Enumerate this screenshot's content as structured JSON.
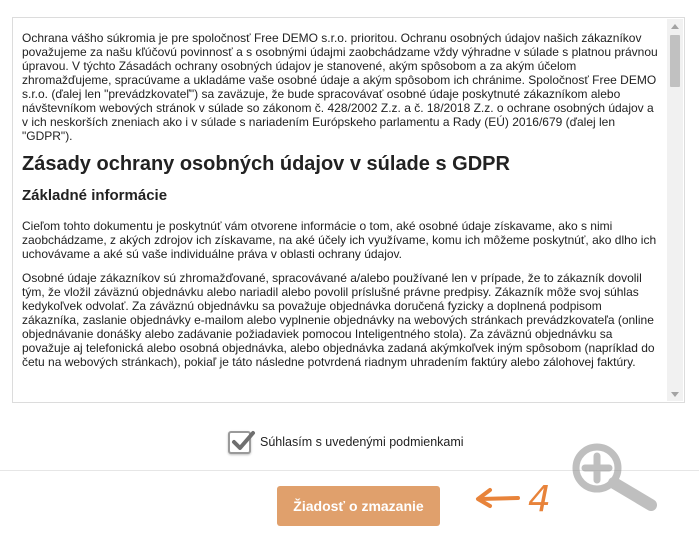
{
  "terms": {
    "intro": "Ochrana vášho súkromia je pre spoločnosť Free DEMO s.r.o. prioritou. Ochranu osobných údajov našich zákazníkov považujeme za našu kľúčovú povinnosť a s osobnými údajmi zaobchádzame vždy výhradne v súlade s platnou právnou úpravou. V týchto Zásadách ochrany osobných údajov je stanovené, akým spôsobom a za akým účelom zhromažďujeme, spracúvame a ukladáme vaše osobné údaje a akým spôsobom ich chránime. Spoločnosť Free DEMO s.r.o. (ďalej len \"prevádzkovateľ\") sa zaväzuje, že bude spracovávať osobné údaje poskytnuté zákazníkom alebo návštevníkom webových stránok v súlade so zákonom č. 428/2002 Z.z. a č. 18/2018 Z.z. o ochrane osobných údajov a v ich neskorších zneniach ako i v súlade s nariadením Európskeho parlamentu a Rady (EÚ) 2016/679 (ďalej len \"GDPR\").",
    "heading": "Zásady ochrany osobných údajov v súlade s GDPR",
    "subheading": "Základné informácie",
    "paragraph1": "Cieľom tohto dokumentu je poskytnúť vám otvorene informácie o tom, aké osobné údaje získavame, ako s nimi zaobchádzame, z akých zdrojov ich získavame, na aké účely ich využívame, komu ich môžeme poskytnúť, ako dlho ich uchovávame a aké sú vaše individuálne práva v oblasti ochrany údajov.",
    "paragraph2": "Osobné údaje zákazníkov sú zhromažďované, spracovávané a/alebo používané len v prípade, že to zákazník dovolil tým, že vložil záväznú objednávku alebo nariadil alebo povolil príslušné právne predpisy. Zákazník môže svoj súhlas kedykoľvek odvolať. Za záväznú objednávku sa považuje objednávka doručená fyzicky a doplnená podpisom zákazníka, zaslanie objednávky e-mailom alebo vyplnenie objednávky na webových stránkach prevádzkovateľa (online objednávanie donášky alebo zadávanie požiadaviek pomocou Inteligentného stola). Za záväznú objednávku sa považuje aj telefonická alebo osobná objednávka, alebo objednávka zadaná akýmkoľvek iným spôsobom (napríklad do četu na webových stránkach), pokiaľ je táto následne potvrdená riadnym uhradením faktúry alebo zálohovej faktúry."
  },
  "consent": {
    "label": "Súhlasím s uvedenými podmienkami",
    "checked": true
  },
  "actions": {
    "delete_request_label": "Žiadosť o zmazanie"
  },
  "annotation": {
    "step": "4"
  },
  "icons": {
    "zoom": "zoom-in-icon",
    "checkmark": "checkmark-icon",
    "arrow": "arrow-left-icon"
  },
  "colors": {
    "button": "#e0a06c",
    "annotation": "#e8833a"
  }
}
